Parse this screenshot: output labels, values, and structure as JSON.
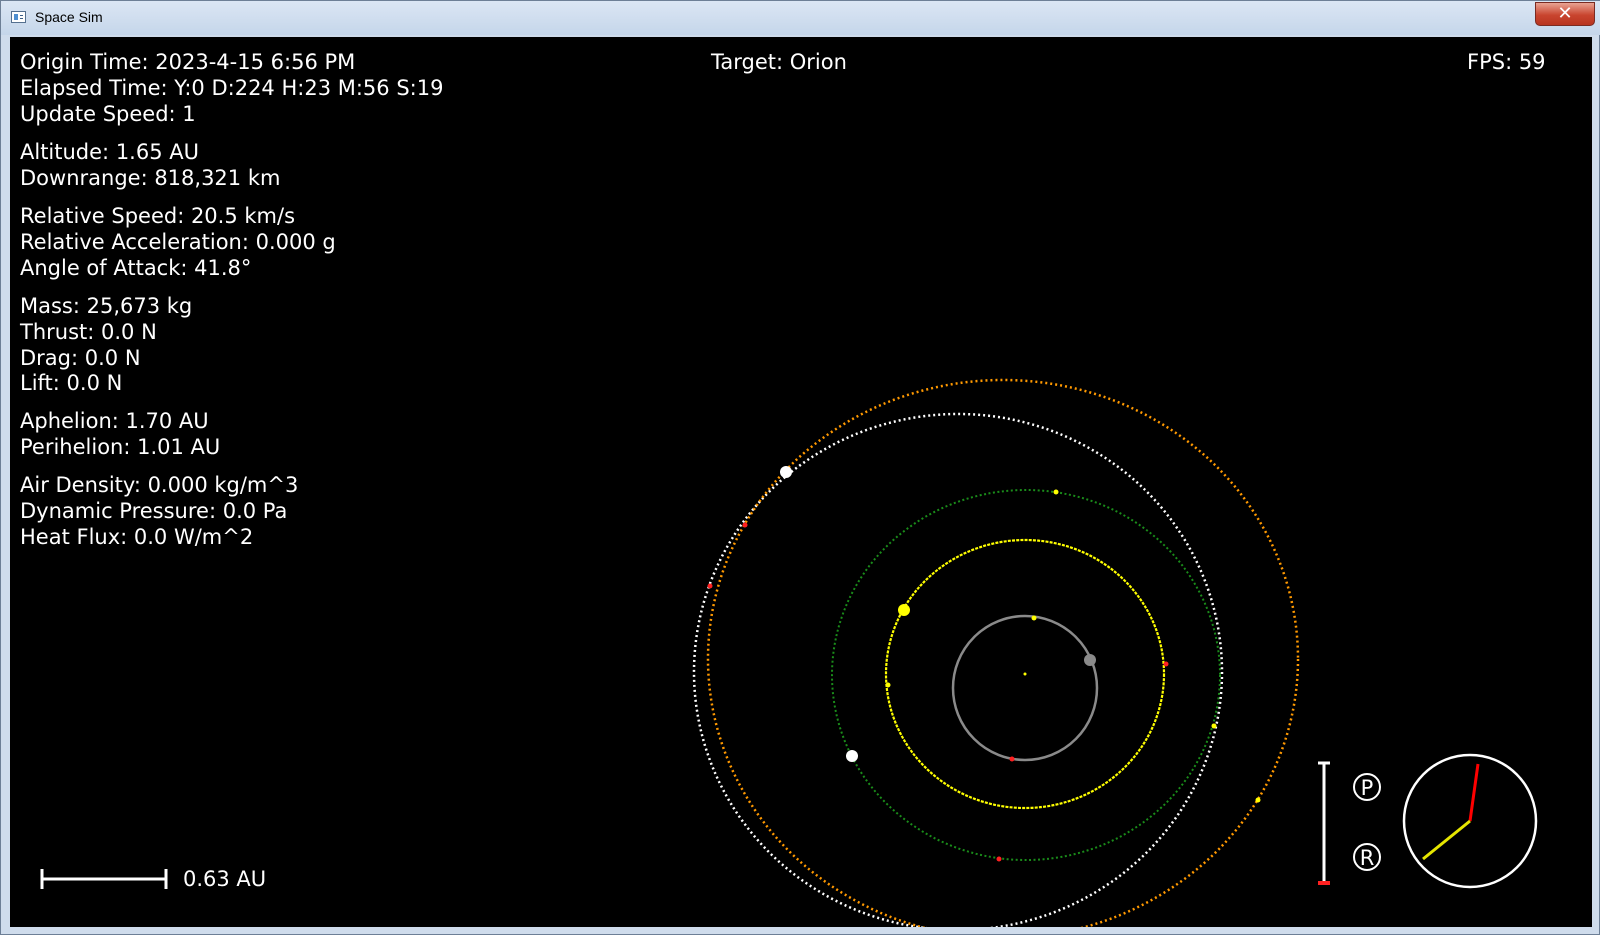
{
  "window": {
    "title": "Space Sim",
    "close_glyph": "✕"
  },
  "hud": {
    "origin_time": "Origin Time: 2023-4-15 6:56 PM",
    "elapsed_time": "Elapsed Time: Y:0 D:224 H:23 M:56 S:19",
    "update_speed": "Update Speed: 1",
    "altitude": "Altitude: 1.65 AU",
    "downrange": "Downrange: 818,321 km",
    "relative_speed": "Relative Speed: 20.5 km/s",
    "relative_acceleration": "Relative Acceleration: 0.000 g",
    "angle_of_attack": "Angle of Attack: 41.8°",
    "mass": "Mass: 25,673 kg",
    "thrust": "Thrust: 0.0 N",
    "drag": "Drag: 0.0 N",
    "lift": "Lift: 0.0 N",
    "aphelion": "Aphelion: 1.70 AU",
    "perihelion": "Perihelion: 1.01 AU",
    "air_density": "Air Density: 0.000 kg/m^3",
    "dynamic_pressure": "Dynamic Pressure: 0.0 Pa",
    "heat_flux": "Heat Flux: 0.0 W/m^2",
    "target": "Target: Orion",
    "fps": "FPS: 59",
    "scale_label": "0.63 AU"
  },
  "controls": {
    "prograde_marker": "P",
    "retrograde_marker": "R"
  },
  "colors": {
    "background": "#000000",
    "text": "#ffffff",
    "orbit_inner": "#8a8a8a",
    "orbit_yellow": "#ffff00",
    "orbit_green": "#1a8c1a",
    "orbit_white": "#ffffff",
    "orbit_orange": "#ff9900",
    "marker_red": "#ff2020",
    "heading_needle": "#ff0000",
    "velocity_needle": "#e6e600"
  }
}
